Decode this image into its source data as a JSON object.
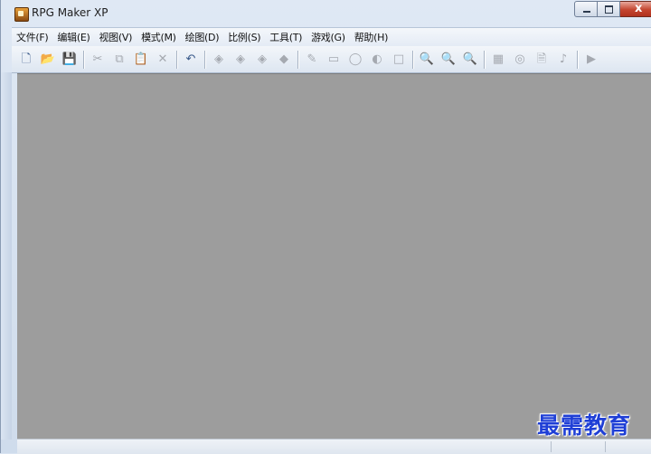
{
  "window": {
    "title": "RPG Maker XP",
    "app_icon": "rpg-maker-icon",
    "caption_buttons": {
      "minimize": "–",
      "maximize": "□",
      "close": "x"
    }
  },
  "menubar": {
    "items": [
      {
        "label": "文件(F)"
      },
      {
        "label": "编辑(E)"
      },
      {
        "label": "视图(V)"
      },
      {
        "label": "模式(M)"
      },
      {
        "label": "绘图(D)"
      },
      {
        "label": "比例(S)"
      },
      {
        "label": "工具(T)"
      },
      {
        "label": "游戏(G)"
      },
      {
        "label": "帮助(H)"
      }
    ]
  },
  "toolbar": {
    "groups": [
      [
        {
          "icon": "new-file-icon",
          "glyph": "🗋",
          "active": true
        },
        {
          "icon": "open-folder-icon",
          "glyph": "📂",
          "active": true
        },
        {
          "icon": "save-icon",
          "glyph": "💾",
          "active": false
        }
      ],
      [
        {
          "icon": "cut-icon",
          "glyph": "✂",
          "active": false
        },
        {
          "icon": "copy-icon",
          "glyph": "⧉",
          "active": false
        },
        {
          "icon": "paste-icon",
          "glyph": "📋",
          "active": false
        },
        {
          "icon": "delete-icon",
          "glyph": "✕",
          "active": false
        }
      ],
      [
        {
          "icon": "undo-icon",
          "glyph": "↶",
          "active": true
        }
      ],
      [
        {
          "icon": "layer1-icon",
          "glyph": "◈",
          "active": false
        },
        {
          "icon": "layer2-icon",
          "glyph": "◈",
          "active": false
        },
        {
          "icon": "layer3-icon",
          "glyph": "◈",
          "active": false
        },
        {
          "icon": "event-layer-icon",
          "glyph": "◆",
          "active": false
        }
      ],
      [
        {
          "icon": "pencil-icon",
          "glyph": "✎",
          "active": false
        },
        {
          "icon": "rectangle-icon",
          "glyph": "▭",
          "active": false
        },
        {
          "icon": "ellipse-icon",
          "glyph": "◯",
          "active": false
        },
        {
          "icon": "fill-icon",
          "glyph": "◐",
          "active": false
        },
        {
          "icon": "select-icon",
          "glyph": "□",
          "active": false
        }
      ],
      [
        {
          "icon": "zoom-1-icon",
          "glyph": "🔍",
          "active": false
        },
        {
          "icon": "zoom-2-icon",
          "glyph": "🔍",
          "active": false
        },
        {
          "icon": "zoom-4-icon",
          "glyph": "🔍",
          "active": false
        }
      ],
      [
        {
          "icon": "database-icon",
          "glyph": "▦",
          "active": false
        },
        {
          "icon": "materials-icon",
          "glyph": "◎",
          "active": false
        },
        {
          "icon": "script-editor-icon",
          "glyph": "🗎",
          "active": false
        },
        {
          "icon": "sound-test-icon",
          "glyph": "♪",
          "active": false
        }
      ],
      [
        {
          "icon": "playtest-icon",
          "glyph": "▶",
          "active": false
        }
      ]
    ]
  },
  "watermark": {
    "text": "最需教育"
  },
  "colors": {
    "workspace": "#9d9d9d",
    "watermark": "#1f3fd6"
  }
}
